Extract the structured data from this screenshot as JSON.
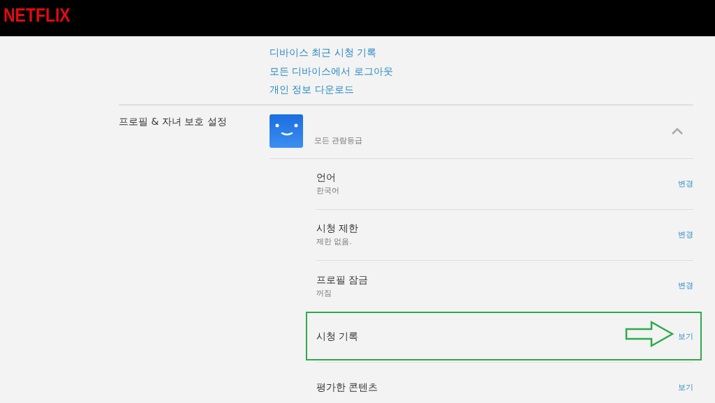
{
  "header": {
    "logo": "NETFLIX"
  },
  "device_links": [
    "디바이스 최근 시청 기록",
    "모든 디바이스에서 로그아웃",
    "개인 정보 다운로드"
  ],
  "profile_section": {
    "label": "프로필 & 자녀 보호 설정",
    "profile": {
      "rating": "모든 관람등급",
      "expanded": true
    },
    "settings": [
      {
        "title": "언어",
        "value": "한국어",
        "action": "변경",
        "highlighted": false
      },
      {
        "title": "시청 제한",
        "value": "제한 없음.",
        "action": "변경",
        "highlighted": false
      },
      {
        "title": "프로필 잠금",
        "value": "꺼짐",
        "action": "변경",
        "highlighted": false
      },
      {
        "title": "시청 기록",
        "action": "보기",
        "highlighted": true
      },
      {
        "title": "평가한 콘텐츠",
        "action": "보기",
        "highlighted": false
      }
    ]
  }
}
